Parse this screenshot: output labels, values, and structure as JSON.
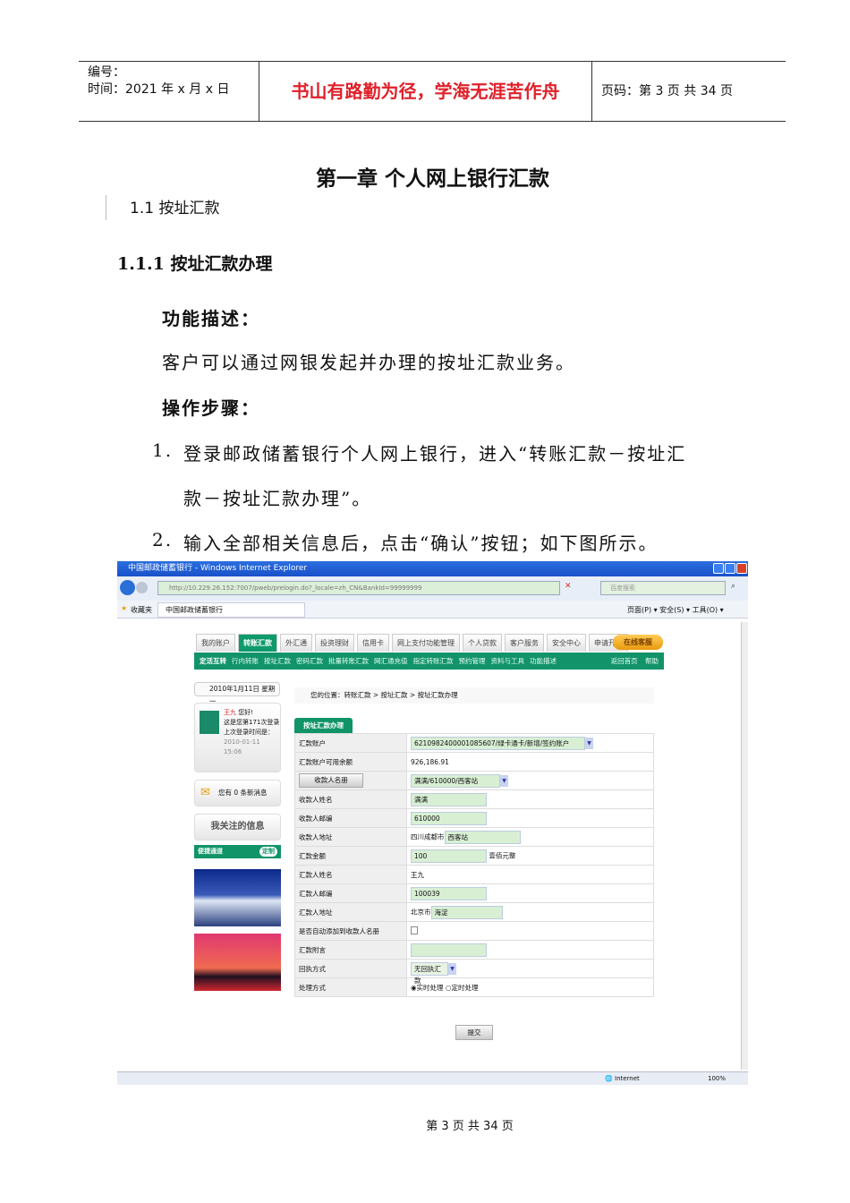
{
  "header": {
    "number_label": "编号：",
    "time_label": "时间：2021 年 x 月 x 日",
    "motto": "书山有路勤为径，学海无涯苦作舟",
    "page_label": "页码：第 3 页  共 34 页"
  },
  "doc": {
    "chapter_title": "第一章  个人网上银行汇款",
    "toc_item": "1.1 按址汇款",
    "section_title": "1.1.1 按址汇款办理",
    "func_heading": "功能描述：",
    "func_text": "客户可以通过网银发起并办理的按址汇款业务。",
    "steps_heading": "操作步骤：",
    "step1_num": "1.",
    "step1_line1": "登录邮政储蓄银行个人网上银行，进入“转账汇款－按址汇",
    "step1_line2": "款－按址汇款办理”。",
    "step2_num": "2.",
    "step2": "输入全部相关信息后，点击“确认”按钮；如下图所示。"
  },
  "browser": {
    "title": "中国邮政储蓄银行 - Windows Internet Explorer",
    "url": "http://10.229.26.152:7007/pweb/prelogin.do?_locale=zh_CN&BankId=99999999",
    "search_placeholder": "百度搜索",
    "favorites": "收藏夹",
    "tab_title": "中国邮政储蓄银行",
    "toolbar": "页面(P) ▾  安全(S) ▾  工具(O) ▾",
    "status_zone": "Internet",
    "zoom": "100%"
  },
  "site": {
    "tabs": [
      "我的账户",
      "转账汇款",
      "外汇通",
      "投资理财",
      "信用卡",
      "网上支付功能管理",
      "个人贷款",
      "客户服务",
      "安全中心",
      "申请开办"
    ],
    "service_button": "在线客服",
    "subnav": [
      "定活互转",
      "行内转账",
      "按址汇款",
      "密码汇款",
      "批量转账汇款",
      "网汇通充值",
      "指定转账汇款",
      "预约管理",
      "资料与工具",
      "功能描述"
    ],
    "home_link": "返回首页",
    "help_link": "帮助",
    "date": "2010年1月11日 星期一",
    "breadcrumb": "您的位置：转账汇款 > 按址汇款 > 按址汇款办理",
    "user_name": "王九",
    "greeting": "您好!",
    "login_count": "这是您第171次登录",
    "last_login_label": "上次登录时间是：",
    "last_login": "2010-01-11 15:06",
    "messages": "您有 0 条新消息",
    "followed": "我关注的信息",
    "shortcut": "便捷通道",
    "customize": "定制",
    "form_tab": "按址汇款办理",
    "rows": {
      "account_label": "汇款账户",
      "account": "6210982400001085607/绿卡通卡/新增/签约账户",
      "balance_label": "汇款账户可用余额",
      "balance": "926,186.91",
      "payee_book_button": "收款人名册",
      "payee_book": "满满/610000/西客站",
      "payee_name_label": "收款人姓名",
      "payee_name": "满满",
      "payee_zip_label": "收款人邮编",
      "payee_zip": "610000",
      "payee_addr_label": "收款人地址",
      "payee_addr_prefix": "四川成都市",
      "payee_addr": "西客站",
      "amount_label": "汇款金额",
      "amount": "100",
      "amount_words": "壹佰元整",
      "sender_name_label": "汇款人姓名",
      "sender_name": "王九",
      "sender_zip_label": "汇款人邮编",
      "sender_zip": "100039",
      "sender_addr_label": "汇款人地址",
      "sender_addr_prefix": "北京市",
      "sender_addr": "海淀",
      "auto_add_label": "是否自动添加到收款人名册",
      "note_label": "汇款附言",
      "receipt_label": "回执方式",
      "receipt": "无回执汇款",
      "process_label": "处理方式",
      "process_realtime": "实时处理",
      "process_scheduled": "定时处理"
    },
    "submit": "提交"
  },
  "footer": "第 3 页 共 34 页"
}
